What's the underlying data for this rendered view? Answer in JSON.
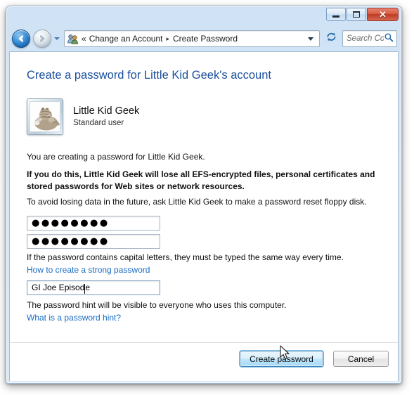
{
  "window": {
    "caption_buttons": {
      "minimize_label": "Minimize",
      "maximize_label": "Maximize",
      "close_label": "✕"
    }
  },
  "navigation": {
    "back_label": "Back",
    "forward_label": "Forward",
    "recent_pages_label": "Recent pages",
    "refresh_label": "Refresh",
    "address": {
      "icon": "user-accounts-icon",
      "overflow_chevron": "«",
      "crumbs": [
        {
          "label": "Change an Account"
        },
        {
          "label": "Create Password"
        }
      ],
      "separator": "▸",
      "dropdown_label": "Previous locations"
    },
    "search": {
      "placeholder": "Search Cont...",
      "icon": "search-icon"
    }
  },
  "page": {
    "title": "Create a password for Little Kid Geek's account",
    "user": {
      "name": "Little Kid Geek",
      "account_type": "Standard user",
      "avatar_alt": "sleeping-kitten-avatar"
    },
    "paragraph_1": "You are creating a password for Little Kid Geek.",
    "warning": "If you do this, Little Kid Geek will lose all EFS-encrypted files, personal certificates and stored passwords for Web sites or network resources.",
    "paragraph_2": "To avoid losing data in the future, ask Little Kid Geek to make a password reset floppy disk.",
    "password_field": {
      "value": "●●●●●●●●",
      "placeholder": ""
    },
    "confirm_password_field": {
      "value": "●●●●●●●●",
      "placeholder": ""
    },
    "capital_letters_note": "If the password contains capital letters, they must be typed the same way every time.",
    "strong_password_link": "How to create a strong password",
    "hint_field": {
      "value_before_caret": "GI Joe Episod",
      "value_after_caret": "e",
      "placeholder": ""
    },
    "hint_note": "The password hint will be visible to everyone who uses this computer.",
    "hint_link": "What is a password hint?"
  },
  "buttons": {
    "create_password": "Create password",
    "cancel": "Cancel"
  },
  "colors": {
    "heading_blue": "#1a4f9c",
    "link_blue": "#1a6bc4",
    "default_button_border": "#3c7fb1",
    "close_button_red": "#bc3a22"
  }
}
